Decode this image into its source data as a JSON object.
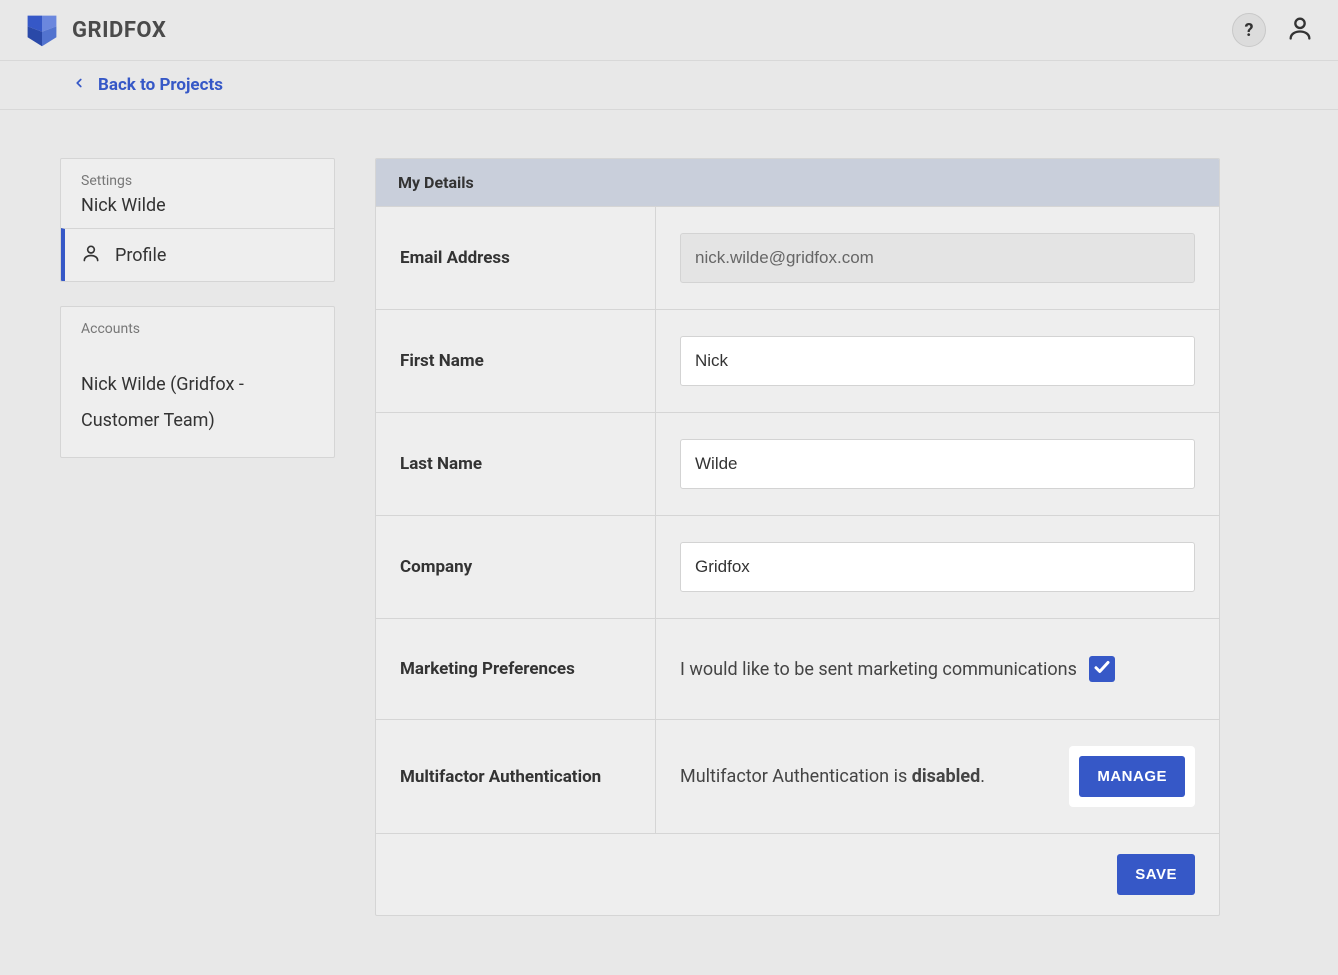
{
  "header": {
    "brand": "GRIDFOX"
  },
  "breadcrumb": {
    "back_label": "Back to Projects"
  },
  "sidebar": {
    "settings_label": "Settings",
    "user_name": "Nick Wilde",
    "profile_label": "Profile",
    "accounts_label": "Accounts",
    "account_name": "Nick Wilde (Gridfox - Customer Team)"
  },
  "panel": {
    "title": "My Details",
    "rows": {
      "email": {
        "label": "Email Address",
        "value": "nick.wilde@gridfox.com"
      },
      "first_name": {
        "label": "First Name",
        "value": "Nick"
      },
      "last_name": {
        "label": "Last Name",
        "value": "Wilde"
      },
      "company": {
        "label": "Company",
        "value": "Gridfox"
      },
      "marketing": {
        "label": "Marketing Preferences",
        "text": "I would like to be sent marketing communications"
      },
      "mfa": {
        "label": "Multifactor Authentication",
        "text_prefix": "Multifactor Authentication is ",
        "status": "disabled",
        "text_suffix": "."
      }
    },
    "manage_label": "MANAGE",
    "save_label": "SAVE"
  }
}
